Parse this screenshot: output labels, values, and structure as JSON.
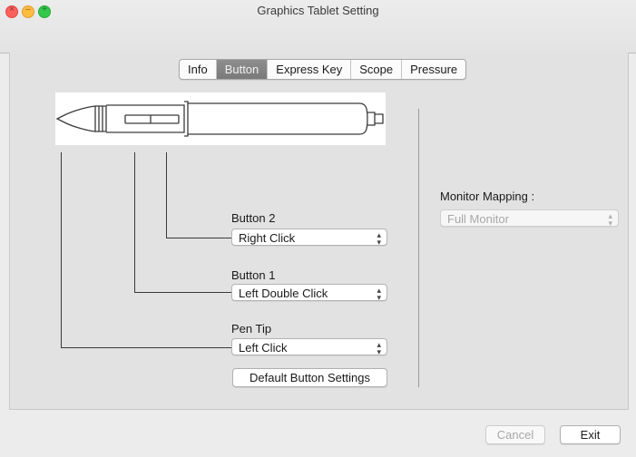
{
  "window": {
    "title": "Graphics Tablet Setting",
    "traffic_lights": [
      "close",
      "minimize",
      "maximize"
    ]
  },
  "tabs": [
    {
      "label": "Info",
      "active": false
    },
    {
      "label": "Button",
      "active": true
    },
    {
      "label": "Express Key",
      "active": false
    },
    {
      "label": "Scope",
      "active": false
    },
    {
      "label": "Pressure",
      "active": false
    }
  ],
  "left_panel": {
    "button2": {
      "label": "Button 2",
      "value": "Right Click"
    },
    "button1": {
      "label": "Button 1",
      "value": "Left Double Click"
    },
    "pen_tip": {
      "label": "Pen Tip",
      "value": "Left Click"
    },
    "default_button_label": "Default Button Settings"
  },
  "right_panel": {
    "monitor_mapping_label": "Monitor Mapping :",
    "monitor_mapping_value": "Full Monitor",
    "monitor_mapping_enabled": false
  },
  "footer": {
    "cancel_label": "Cancel",
    "exit_label": "Exit"
  },
  "colors": {
    "active_tab": "#858585",
    "close_light": "#fc605c",
    "min_light": "#fdbc40",
    "max_light": "#34c84a"
  }
}
